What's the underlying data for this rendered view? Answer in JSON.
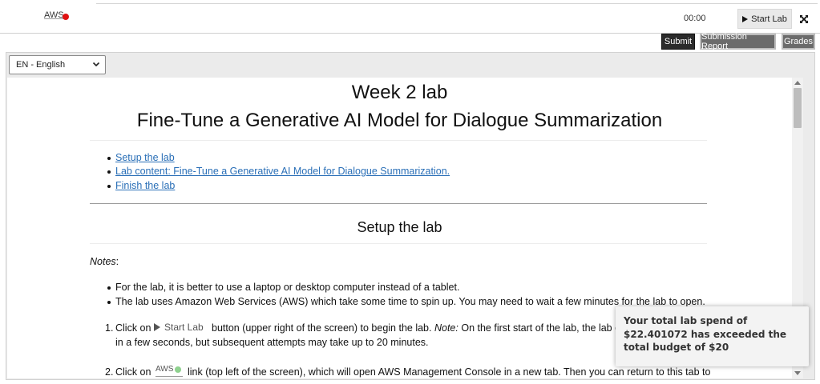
{
  "topbar": {
    "aws_label": "AWS",
    "aws_status_color": "#e01010",
    "timer": "00:00",
    "start_lab_label": "Start Lab",
    "fullscreen_icon": "expand-arrows-icon"
  },
  "actions": {
    "submit_label": "Submit",
    "submission_report_label": "Submission Report",
    "grades_label": "Grades"
  },
  "language_select": {
    "selected": "EN - English"
  },
  "content": {
    "week_title": "Week 2 lab",
    "main_title": "Fine-Tune a Generative AI Model for Dialogue Summarization",
    "toc": [
      "Setup the lab",
      "Lab content: Fine-Tune a Generative AI Model for Dialogue Summarization.",
      "Finish the lab"
    ],
    "setup_heading": "Setup the lab",
    "notes_label": "Notes",
    "notes_colon": ":",
    "bullets": [
      "For the lab, it is better to use a laptop or desktop computer instead of a tablet.",
      "The lab uses Amazon Web Services (AWS) which take some time to spin up. You may need to wait a few minutes for the lab to open."
    ],
    "step1": {
      "number": "1.",
      "prefix": "Click on",
      "inline_button": "Start Lab",
      "text_a": "button (upper right of the screen) to begin the lab.",
      "note_label": "Note:",
      "text_b": "On the first start of the lab, the lab env",
      "line2": "in a few seconds, but subsequent attempts may take up to 20 minutes."
    },
    "step2": {
      "number": "2.",
      "prefix": "Click on",
      "inline_link": "AWS",
      "text": "link (top left of the screen), which will open AWS Management Console in a new tab. Then you can return to this tab to"
    }
  },
  "toast": {
    "message_lines": [
      "Your total lab spend of",
      "$22.401072 has exceeded the",
      "total budget of $20"
    ]
  },
  "colors": {
    "link": "#2a6fb7",
    "submit_bg": "#2b2b2b",
    "secondary_btn_bg": "#6b6b6b"
  }
}
